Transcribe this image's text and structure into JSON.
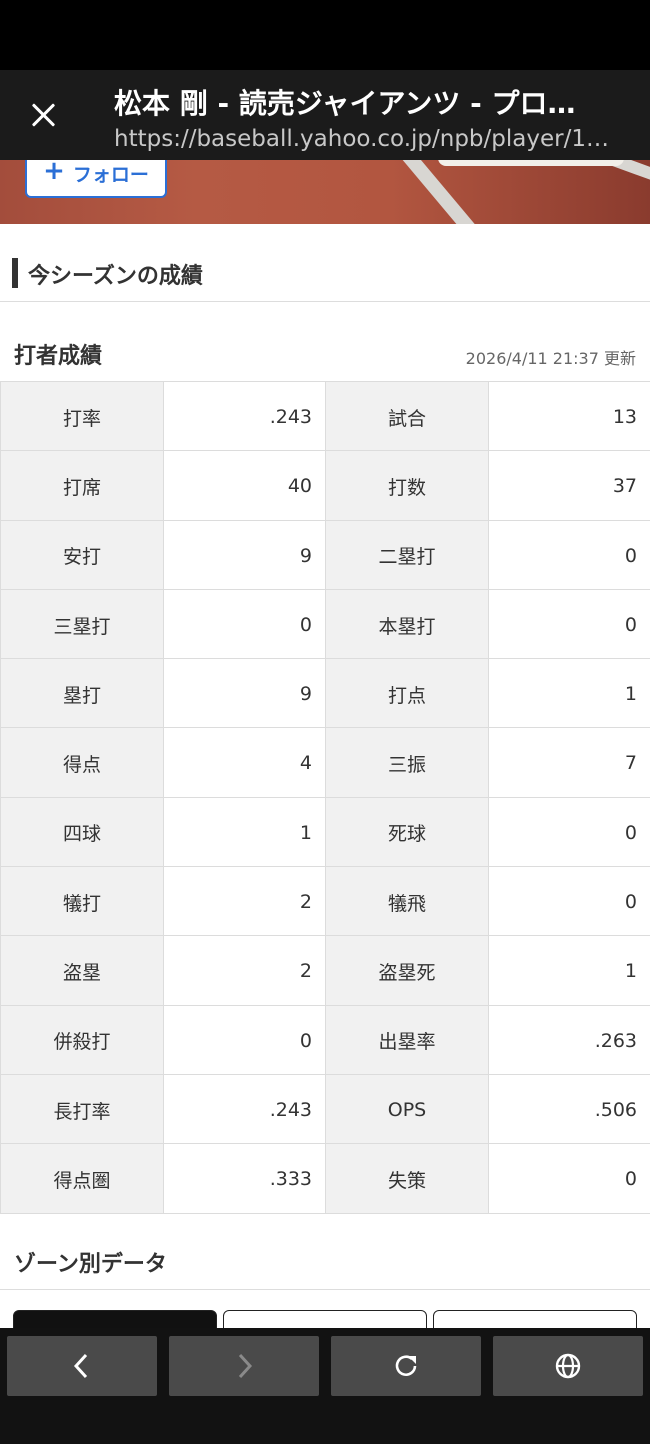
{
  "browser": {
    "page_title": "松本 剛 - 読売ジャイアンツ - プロ…",
    "url": "https://baseball.yahoo.co.jp/npb/player/1…"
  },
  "profile": {
    "follow_label": "フォロー"
  },
  "season": {
    "section_title": "今シーズンの成績",
    "batting_title": "打者成績",
    "updated_text": "2026/4/11 21:37 更新",
    "rows": [
      [
        {
          "label": "打率",
          "value": ".243"
        },
        {
          "label": "試合",
          "value": "13"
        }
      ],
      [
        {
          "label": "打席",
          "value": "40"
        },
        {
          "label": "打数",
          "value": "37"
        }
      ],
      [
        {
          "label": "安打",
          "value": "9"
        },
        {
          "label": "二塁打",
          "value": "0"
        }
      ],
      [
        {
          "label": "三塁打",
          "value": "0"
        },
        {
          "label": "本塁打",
          "value": "0"
        }
      ],
      [
        {
          "label": "塁打",
          "value": "9"
        },
        {
          "label": "打点",
          "value": "1"
        }
      ],
      [
        {
          "label": "得点",
          "value": "4"
        },
        {
          "label": "三振",
          "value": "7"
        }
      ],
      [
        {
          "label": "四球",
          "value": "1"
        },
        {
          "label": "死球",
          "value": "0"
        }
      ],
      [
        {
          "label": "犠打",
          "value": "2"
        },
        {
          "label": "犠飛",
          "value": "0"
        }
      ],
      [
        {
          "label": "盗塁",
          "value": "2"
        },
        {
          "label": "盗塁死",
          "value": "1"
        }
      ],
      [
        {
          "label": "併殺打",
          "value": "0"
        },
        {
          "label": "出塁率",
          "value": ".263"
        }
      ],
      [
        {
          "label": "長打率",
          "value": ".243"
        },
        {
          "label": "OPS",
          "value": ".506"
        }
      ],
      [
        {
          "label": "得点圏",
          "value": ".333"
        },
        {
          "label": "失策",
          "value": "0"
        }
      ]
    ]
  },
  "zone": {
    "section_title": "ゾーン別データ"
  },
  "bottom_nav": {
    "back_icon": "chevron-left-icon",
    "forward_icon": "chevron-right-icon",
    "reload_icon": "reload-icon",
    "globe_icon": "globe-icon"
  }
}
